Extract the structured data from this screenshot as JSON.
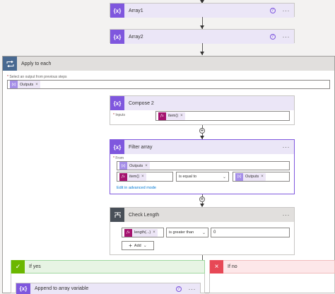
{
  "steps": {
    "array1": {
      "title": "Array1",
      "icon": "variable-icon"
    },
    "array2": {
      "title": "Array2",
      "icon": "variable-icon"
    }
  },
  "apply_to_each": {
    "title": "Apply to each",
    "select_label": "Select an output from previous steps",
    "token": "Outputs"
  },
  "compose2": {
    "title": "Compose 2",
    "inputs_label": "Inputs",
    "token": "item()"
  },
  "filter_array": {
    "title": "Filter array",
    "from_label": "From",
    "from_token": "Outputs",
    "left_token": "item()",
    "operator": "is equal to",
    "right_token": "Outputs",
    "advanced_link": "Edit in advanced mode"
  },
  "check_length": {
    "title": "Check Length",
    "left_token": "length(...)",
    "operator": "is greater than",
    "value": "0",
    "add_label": "Add"
  },
  "branches": {
    "yes": "If yes",
    "no": "If no"
  },
  "append": {
    "title": "Append to array variable"
  },
  "glyphs": {
    "help": "?",
    "more": "···",
    "remove": "×",
    "plus": "+",
    "var": "{x}",
    "fx": "fx"
  },
  "colors": {
    "variable": "#7f57de",
    "loop": "#486991",
    "condition": "#484f58",
    "expression": "#a4126e",
    "link": "#0078d4"
  }
}
